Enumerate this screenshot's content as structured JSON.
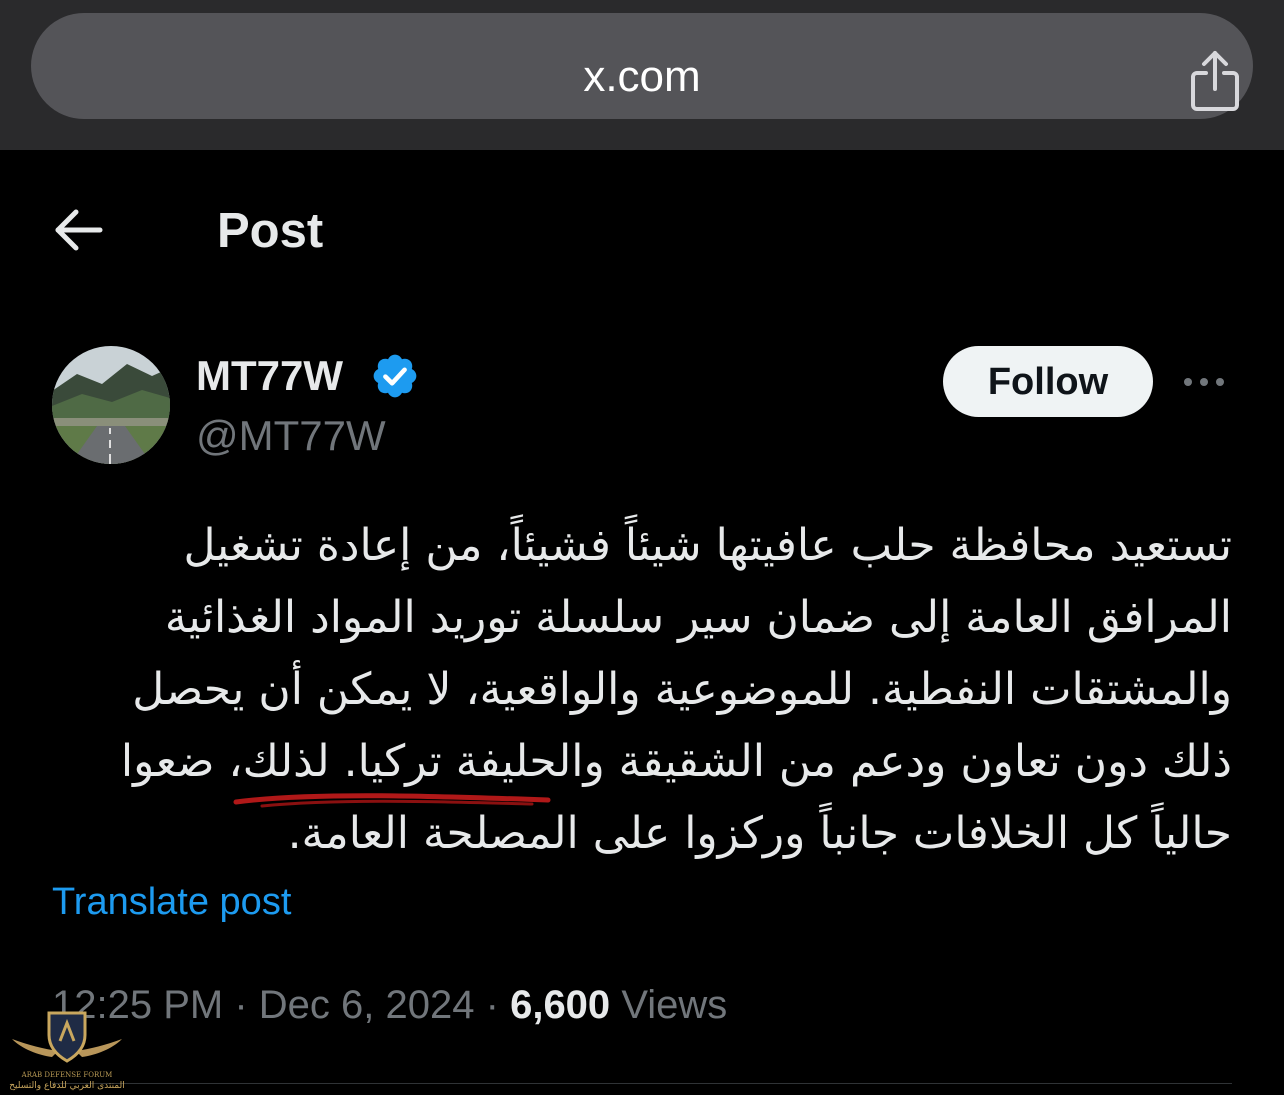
{
  "browser": {
    "url": "x.com",
    "share_icon": "share-icon"
  },
  "header": {
    "back_icon": "arrow-left-icon",
    "title": "Post"
  },
  "author": {
    "display_name": "MT77W",
    "handle": "@MT77W",
    "verified": true,
    "verified_color": "#1d9bf0",
    "follow_label": "Follow",
    "more_icon": "more-horizontal-icon"
  },
  "post": {
    "text": "تستعيد محافظة حلب عافيتها شيئاً فشيئاً، من إعادة تشغيل المرافق العامة إلى ضمان سير سلسلة توريد المواد الغذائية والمشتقات النفطية. للموضوعية والواقعية، لا يمكن أن يحصل ذلك دون تعاون ودعم من الشقيقة والحليفة تركيا. لذلك، ضعوا حالياً كل الخلافات جانباً وركزوا على المصلحة العامة.",
    "translate_label": "Translate post",
    "time": "12:25 PM",
    "separator": "·",
    "date": "Dec 6, 2024",
    "views_count": "6,600",
    "views_label": "Views"
  },
  "colors": {
    "background": "#000000",
    "link": "#1d9bf0",
    "secondary_text": "#71767b",
    "primary_text": "#e7e9ea"
  },
  "watermark": {
    "line1": "ARAB DEFENSE FORUM",
    "line2": "المنتدى العربي للدفاع والتسليح"
  }
}
